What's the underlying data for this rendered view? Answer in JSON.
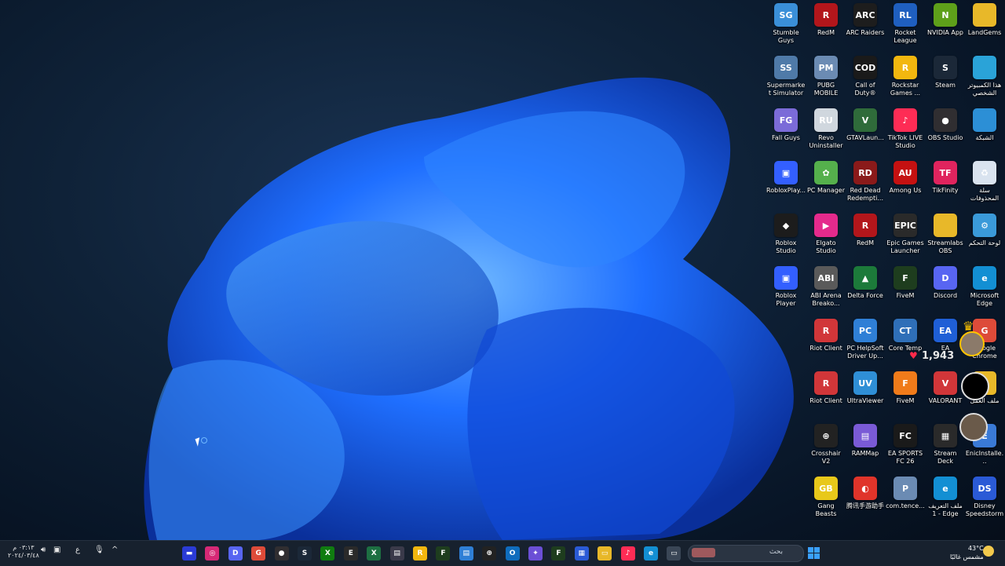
{
  "desktop": {
    "icons": [
      {
        "label": "Stumble Guys",
        "color": "#3a8fd8",
        "glyph": "SG"
      },
      {
        "label": "RedM",
        "color": "#b3161b",
        "glyph": "R"
      },
      {
        "label": "ARC Raiders",
        "color": "#1d1d1d",
        "glyph": "ARC"
      },
      {
        "label": "Rocket League",
        "color": "#1f5fbf",
        "glyph": "RL"
      },
      {
        "label": "NVIDIA App",
        "color": "#5ea01a",
        "glyph": "N"
      },
      {
        "label": "LandGems",
        "color": "#e8b829",
        "glyph": ""
      },
      {
        "label": "Supermarket Simulator",
        "color": "#4f7aa8",
        "glyph": "SS"
      },
      {
        "label": "PUBG MOBILE",
        "color": "#6b8bb3",
        "glyph": "PM"
      },
      {
        "label": "Call of Duty®",
        "color": "#1a1a1a",
        "glyph": "COD"
      },
      {
        "label": "Rockstar Games ...",
        "color": "#f2b70f",
        "glyph": "R"
      },
      {
        "label": "Steam",
        "color": "#1b2838",
        "glyph": "S"
      },
      {
        "label": "هذا الكمبيوتر الشخصي",
        "color": "#2aa3d8",
        "glyph": ""
      },
      {
        "label": "Fall Guys",
        "color": "#7b6bd8",
        "glyph": "FG"
      },
      {
        "label": "Revo Uninstaller",
        "color": "#d0d7de",
        "glyph": "RU"
      },
      {
        "label": "GTAVLaun...",
        "color": "#2f6b3a",
        "glyph": "V"
      },
      {
        "label": "TikTok LIVE Studio",
        "color": "#fe2c55",
        "glyph": "♪"
      },
      {
        "label": "OBS Studio",
        "color": "#302e31",
        "glyph": "●"
      },
      {
        "label": "الشبكة",
        "color": "#2c8fd6",
        "glyph": ""
      },
      {
        "label": "RobloxPlay...",
        "color": "#335fff",
        "glyph": "▣"
      },
      {
        "label": "PC Manager",
        "color": "#55b04c",
        "glyph": "✿"
      },
      {
        "label": "Red Dead Redempti...",
        "color": "#8a1a1a",
        "glyph": "RD"
      },
      {
        "label": "Among Us",
        "color": "#c51111",
        "glyph": "AU"
      },
      {
        "label": "TikFinity",
        "color": "#e0245e",
        "glyph": "TF"
      },
      {
        "label": "سلة المحذوفات",
        "color": "#d9e3ef",
        "glyph": "♻"
      },
      {
        "label": "Roblox Studio",
        "color": "#1c1c1c",
        "glyph": "◆"
      },
      {
        "label": "Elgato Studio",
        "color": "#e52a8c",
        "glyph": "▶"
      },
      {
        "label": "RedM",
        "color": "#b3161b",
        "glyph": "R"
      },
      {
        "label": "Epic Games Launcher",
        "color": "#2a2a2a",
        "glyph": "EPIC"
      },
      {
        "label": "Streamlabs OBS",
        "color": "#e8b829",
        "glyph": ""
      },
      {
        "label": "لوحة التحكم",
        "color": "#3a9ad9",
        "glyph": "⚙"
      },
      {
        "label": "Roblox Player",
        "color": "#335fff",
        "glyph": "▣"
      },
      {
        "label": "ABI Arena Breako...",
        "color": "#5a5a5a",
        "glyph": "ABI"
      },
      {
        "label": "Delta Force",
        "color": "#1c7a3a",
        "glyph": "▲"
      },
      {
        "label": "FiveM",
        "color": "#1e3d1e",
        "glyph": "F"
      },
      {
        "label": "Discord",
        "color": "#5865f2",
        "glyph": "D"
      },
      {
        "label": "Microsoft Edge",
        "color": "#138fd3",
        "glyph": "e"
      },
      {
        "label": "",
        "color": "transparent",
        "glyph": ""
      },
      {
        "label": "Riot Client",
        "color": "#d13639",
        "glyph": "R"
      },
      {
        "label": "PC HelpSoft Driver Up...",
        "color": "#2f7fd6",
        "glyph": "PC"
      },
      {
        "label": "Core Temp",
        "color": "#2f6fb8",
        "glyph": "CT"
      },
      {
        "label": "EA",
        "color": "#1f5fd6",
        "glyph": "EA"
      },
      {
        "label": "Google Chrome",
        "color": "#dd4b39",
        "glyph": "G"
      },
      {
        "label": "",
        "color": "transparent",
        "glyph": ""
      },
      {
        "label": "Riot Client",
        "color": "#d13639",
        "glyph": "R"
      },
      {
        "label": "UltraViewer",
        "color": "#2f8fd6",
        "glyph": "UV"
      },
      {
        "label": "FiveM",
        "color": "#f07b1a",
        "glyph": "F"
      },
      {
        "label": "VALORANT",
        "color": "#d13639",
        "glyph": "V"
      },
      {
        "label": "ملف العمل",
        "color": "#e8b829",
        "glyph": ""
      },
      {
        "label": "",
        "color": "transparent",
        "glyph": ""
      },
      {
        "label": "Crosshair V2",
        "color": "#222",
        "glyph": "⊕"
      },
      {
        "label": "RAMMap",
        "color": "#7a5ad6",
        "glyph": "▤"
      },
      {
        "label": "EA SPORTS FC 26",
        "color": "#1a1a1a",
        "glyph": "FC"
      },
      {
        "label": "Stream Deck",
        "color": "#2a2a2a",
        "glyph": "▦"
      },
      {
        "label": "EnicInstalle...",
        "color": "#3a7ad6",
        "glyph": "E"
      },
      {
        "label": "",
        "color": "transparent",
        "glyph": ""
      },
      {
        "label": "Gang Beasts",
        "color": "#e8c81a",
        "glyph": "GB"
      },
      {
        "label": "腾讯手游助手",
        "color": "#e0342a",
        "glyph": "◐"
      },
      {
        "label": "com.tence...",
        "color": "#6b8bb3",
        "glyph": "P"
      },
      {
        "label": "ملف التعريف 1 - Edge",
        "color": "#138fd3",
        "glyph": "e"
      },
      {
        "label": "Disney Speedstorm",
        "color": "#2a5ad6",
        "glyph": "DS"
      }
    ]
  },
  "overlay": {
    "like_count": "1,943"
  },
  "taskbar": {
    "search_placeholder": "بحث",
    "weather_temp": "43°C",
    "weather_desc": "مشمس غالبًا",
    "clock_time": "٠٣:١٣ م",
    "clock_date": "٢٠٢٤/٠٣/٤٨",
    "lang": "ع",
    "apps": [
      {
        "name": "media-app-icon",
        "color": "#2a3bd6",
        "glyph": "▬"
      },
      {
        "name": "instagram-icon",
        "color": "#d62976",
        "glyph": "◎"
      },
      {
        "name": "discord-icon",
        "color": "#5865f2",
        "glyph": "D"
      },
      {
        "name": "chrome-icon",
        "color": "#dd4b39",
        "glyph": "G"
      },
      {
        "name": "obs-icon",
        "color": "#302e31",
        "glyph": "●"
      },
      {
        "name": "steam-icon",
        "color": "#1b2838",
        "glyph": "S"
      },
      {
        "name": "xbox-icon",
        "color": "#107c10",
        "glyph": "X"
      },
      {
        "name": "epic-icon",
        "color": "#2a2a2a",
        "glyph": "E"
      },
      {
        "name": "excel-icon",
        "color": "#1d6f42",
        "glyph": "X"
      },
      {
        "name": "app-icon",
        "color": "#3a3a4a",
        "glyph": "▤"
      },
      {
        "name": "rockstar-icon",
        "color": "#f2b70f",
        "glyph": "R"
      },
      {
        "name": "fivem-icon",
        "color": "#1e3d1e",
        "glyph": "F"
      },
      {
        "name": "file-app-icon",
        "color": "#2f7fd6",
        "glyph": "▤"
      },
      {
        "name": "crosshair-icon",
        "color": "#222",
        "glyph": "⊕"
      },
      {
        "name": "outlook-icon",
        "color": "#0f6cbd",
        "glyph": "O"
      },
      {
        "name": "copilot-icon",
        "color": "#6b4fd6",
        "glyph": "✦"
      },
      {
        "name": "fivem-tray-icon",
        "color": "#1e3d1e",
        "glyph": "F"
      },
      {
        "name": "store-icon",
        "color": "#2a5ad6",
        "glyph": "▦"
      },
      {
        "name": "explorer-icon",
        "color": "#e8b829",
        "glyph": "▭"
      },
      {
        "name": "tiktok-icon",
        "color": "#fe2c55",
        "glyph": "♪"
      },
      {
        "name": "edge-icon",
        "color": "#138fd3",
        "glyph": "e"
      },
      {
        "name": "taskview-icon",
        "color": "#3a4656",
        "glyph": "▭"
      }
    ]
  },
  "colors": {
    "accent": "#1f6fff",
    "taskbar": "#17212e"
  }
}
